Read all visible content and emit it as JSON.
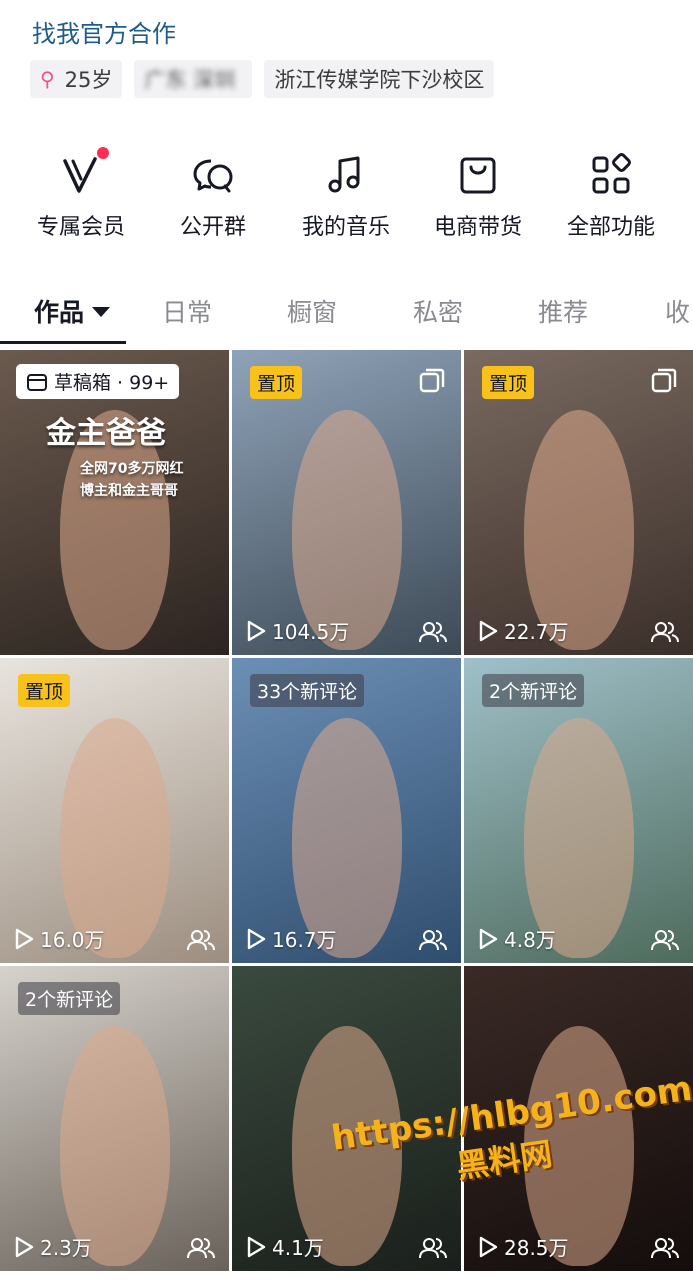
{
  "header": {
    "link_text": "找我官方合作"
  },
  "profile_info": {
    "age": "25岁",
    "location_blurred": "广东 深圳",
    "school": "浙江传媒学院下沙校区"
  },
  "functions": [
    {
      "label": "专属会员",
      "icon": "vip-v-icon",
      "has_dot": true
    },
    {
      "label": "公开群",
      "icon": "group-chat-icon",
      "has_dot": false
    },
    {
      "label": "我的音乐",
      "icon": "music-note-icon",
      "has_dot": false
    },
    {
      "label": "电商带货",
      "icon": "shopping-bag-icon",
      "has_dot": false
    },
    {
      "label": "全部功能",
      "icon": "grid-apps-icon",
      "has_dot": false
    }
  ],
  "tabs": [
    {
      "label": "作品",
      "active": true
    },
    {
      "label": "日常",
      "active": false
    },
    {
      "label": "橱窗",
      "active": false
    },
    {
      "label": "私密",
      "active": false
    },
    {
      "label": "推荐",
      "active": false
    },
    {
      "label": "收",
      "active": false
    }
  ],
  "videos": [
    {
      "badge_type": "draft",
      "badge": "草稿箱 · 99+",
      "views": "",
      "overlay_title": "金主爸爸",
      "overlay_sub": "全网70多万网红\n博主和金主哥哥",
      "bg": [
        "#6b5a4e",
        "#2c2420"
      ]
    },
    {
      "badge_type": "pin",
      "badge": "置顶",
      "views": "104.5万",
      "multi": true,
      "bg": [
        "#8fa3b8",
        "#3d4a56"
      ]
    },
    {
      "badge_type": "pin",
      "badge": "置顶",
      "views": "22.7万",
      "multi": true,
      "bg": [
        "#7a6a60",
        "#3b2f2a"
      ]
    },
    {
      "badge_type": "pin",
      "badge": "置顶",
      "views": "16.0万",
      "bg": [
        "#e8e4de",
        "#9c8e80"
      ]
    },
    {
      "badge_type": "comment",
      "badge": "33个新评论",
      "views": "16.7万",
      "bg": [
        "#6c8fb5",
        "#2f4d6e"
      ]
    },
    {
      "badge_type": "comment",
      "badge": "2个新评论",
      "views": "4.8万",
      "bg": [
        "#9fc0c9",
        "#4e6b5c"
      ]
    },
    {
      "badge_type": "comment",
      "badge": "2个新评论",
      "views": "2.3万",
      "bg": [
        "#d6d2cc",
        "#6a625a"
      ]
    },
    {
      "badge_type": "none",
      "badge": "",
      "views": "4.1万",
      "bg": [
        "#3a4a3e",
        "#1a1f1b"
      ]
    },
    {
      "badge_type": "none",
      "badge": "",
      "views": "28.5万",
      "bg": [
        "#3a2a26",
        "#140d0c"
      ]
    }
  ],
  "watermark": {
    "url": "https://hlbg10.com",
    "name": "黑料网"
  },
  "colors": {
    "pin_badge": "#f8c21b",
    "accent_dot": "#fe2c55",
    "link": "#1e5c8a"
  }
}
